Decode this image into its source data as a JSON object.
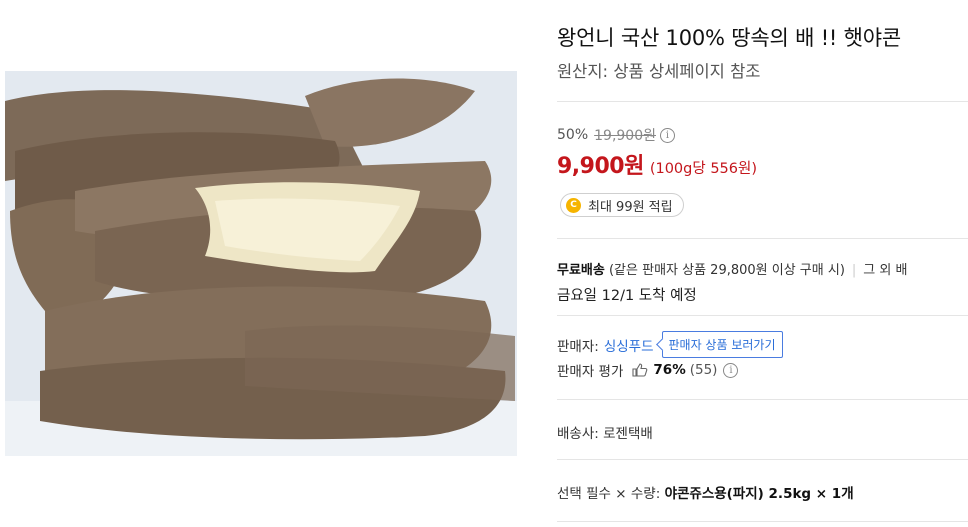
{
  "product": {
    "image_alt": "yacon-photo",
    "title": "왕언니 국산 100% 땅속의 배 !! 햇야콘",
    "origin": "원산지: 상품 상세페이지 참조"
  },
  "pricing": {
    "discount_rate": "50%",
    "original_price": "19,900원",
    "sale_price": "9,900원",
    "unit_price": "(100g당 556원)",
    "points": "최대 99원 적립",
    "coin_letter": "C"
  },
  "shipping": {
    "free_label": "무료배송",
    "condition": "(같은 판매자 상품 29,800원 이상 구매 시)",
    "extra": "그 외 배",
    "arrival": "금요일 12/1 도착 예정"
  },
  "seller": {
    "label": "판매자:",
    "name": "싱싱푸드",
    "button": "판매자 상품 보러가기",
    "rating_label": "판매자 평가",
    "rating_pct": "76%",
    "rating_count": "(55)"
  },
  "courier": "배송사: 로젠택배",
  "option": {
    "label": "선택 필수 × 수량:",
    "value": "야콘쥬스용(파지) 2.5kg × 1개"
  },
  "colors": {
    "price_red": "#c4161c",
    "link_blue": "#2a6ed8",
    "coin_yellow": "#f6b400"
  }
}
